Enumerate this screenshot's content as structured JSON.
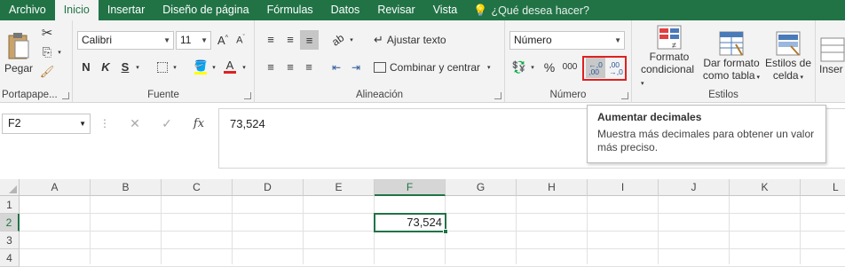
{
  "tabs": [
    {
      "label": "Archivo"
    },
    {
      "label": "Inicio"
    },
    {
      "label": "Insertar"
    },
    {
      "label": "Diseño de página"
    },
    {
      "label": "Fórmulas"
    },
    {
      "label": "Datos"
    },
    {
      "label": "Revisar"
    },
    {
      "label": "Vista"
    }
  ],
  "tell_me": "¿Qué desea hacer?",
  "clipboard": {
    "paste_label": "Pegar",
    "group_label": "Portapape..."
  },
  "font": {
    "name": "Calibri",
    "size": "11",
    "group_label": "Fuente",
    "bold": "N",
    "italic": "K",
    "underline": "S"
  },
  "alignment": {
    "wrap_label": "Ajustar texto",
    "merge_label": "Combinar y centrar",
    "group_label": "Alineación"
  },
  "number": {
    "format": "Número",
    "group_label": "Número",
    "percent": "%",
    "thousands": "000"
  },
  "styles": {
    "conditional_line1": "Formato",
    "conditional_line2": "condicional",
    "table_line1": "Dar formato",
    "table_line2": "como tabla",
    "cell_line1": "Estilos de",
    "cell_line2": "celda",
    "group_label": "Estilos"
  },
  "cells": {
    "insert_label": "Inser"
  },
  "formula_bar": {
    "name_box": "F2",
    "fx": "fx",
    "value": "73,524"
  },
  "tooltip": {
    "title": "Aumentar decimales",
    "description": "Muestra más decimales para obtener un valor más preciso."
  },
  "grid": {
    "columns": [
      "A",
      "B",
      "C",
      "D",
      "E",
      "F",
      "G",
      "H",
      "I",
      "J",
      "K",
      "L"
    ],
    "rows": [
      "1",
      "2",
      "3",
      "4"
    ],
    "active_cell_value": "73,524"
  },
  "colors": {
    "brand": "#217346",
    "highlight_box": "#e02020"
  }
}
